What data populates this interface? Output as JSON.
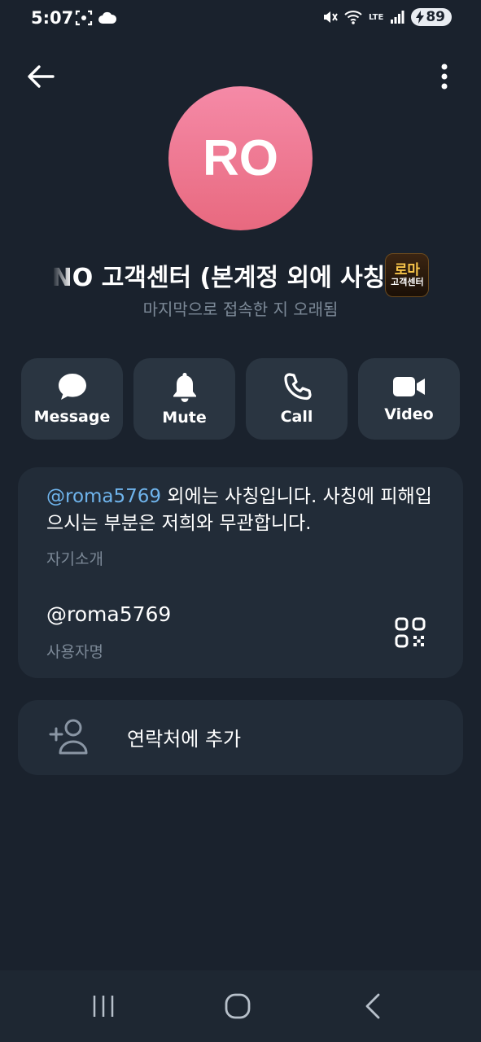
{
  "status": {
    "time": "5:07",
    "battery": "89",
    "network": "LTE"
  },
  "profile": {
    "initials": "RO",
    "name": "NO 고객센터 (본계정 외에 사칭",
    "badge_top": "로마",
    "badge_bottom": "고객센터",
    "last_seen": "마지막으로 접속한 지 오래됨",
    "avatar_color": "#f07c97"
  },
  "actions": [
    {
      "label": "Message",
      "icon": "chat-bubble-icon"
    },
    {
      "label": "Mute",
      "icon": "bell-icon"
    },
    {
      "label": "Call",
      "icon": "phone-icon"
    },
    {
      "label": "Video",
      "icon": "video-camera-icon"
    }
  ],
  "info": {
    "bio_link": "@roma5769",
    "bio_text": " 외에는 사칭입니다. 사칭에 피해입으시는 부분은 저희와 무관합니다.",
    "bio_label": "자기소개",
    "username": "@roma5769",
    "username_label": "사용자명"
  },
  "add_contact": {
    "label": "연락처에 추가"
  },
  "colors": {
    "background": "#1a222d",
    "card": "#222c38",
    "button": "#2a3541",
    "link": "#6fb4ec",
    "secondary_text": "#7c8997"
  }
}
